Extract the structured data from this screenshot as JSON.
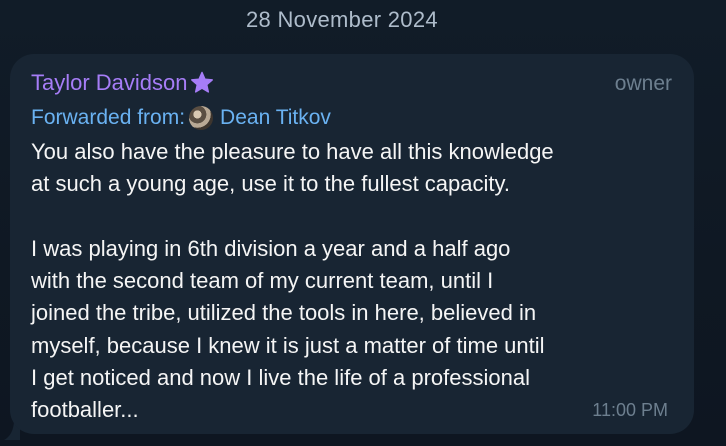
{
  "date_label": "28 November 2024",
  "message": {
    "sender_name": "Taylor Davidson",
    "role": "owner",
    "forwarded_label": "Forwarded from:",
    "forwarded_name": "Dean Titkov",
    "text": "You also have the pleasure to have all this knowledge\nat such a young age, use it to the fullest capacity.\n\nI was playing in 6th division a year and a half ago\nwith the second team of my current team, until I\njoined the tribe, utilized the tools in here, believed in\nmyself, because I knew it is just a matter of time until\nI get noticed and now I live the life of a professional\nfootballer...",
    "time": "11:00 PM"
  },
  "icons": {
    "sender_badge": "star-icon",
    "forwarded_avatar": "avatar"
  },
  "colors": {
    "background": "#0e1621",
    "bubble": "#182533",
    "sender_name": "#a67df7",
    "forwarded": "#6ab2f2",
    "message_text": "#f5f5f5",
    "meta": "#6d7f8f",
    "date_label": "#aebccb"
  }
}
